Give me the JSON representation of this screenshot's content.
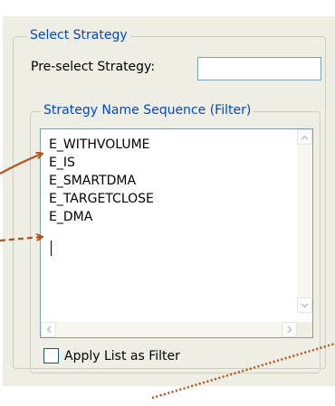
{
  "group": {
    "title": "Select Strategy"
  },
  "preselect": {
    "label": "Pre-select Strategy:",
    "value": ""
  },
  "sequence_group": {
    "title": "Strategy Name Sequence (Filter)"
  },
  "list": {
    "items": [
      "E_WITHVOLUME",
      "E_IS",
      "E_SMARTDMA",
      "E_TARGETCLOSE",
      "E_DMA"
    ]
  },
  "filter_checkbox": {
    "label": "Apply List as Filter",
    "checked": false
  },
  "annotation_color": "#b5521c"
}
